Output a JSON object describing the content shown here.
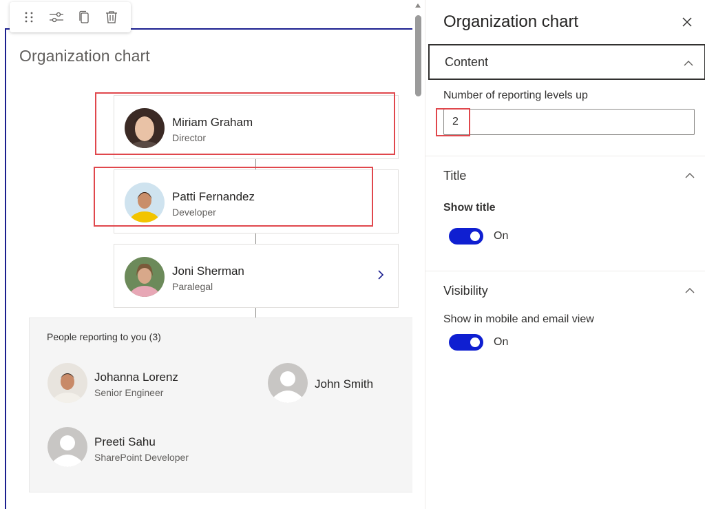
{
  "toolbar": {
    "icons": [
      "drag-handle-icon",
      "settings-sliders-icon",
      "duplicate-icon",
      "delete-trash-icon"
    ]
  },
  "webpart": {
    "title": "Organization chart"
  },
  "chain": [
    {
      "name": "Miriam Graham",
      "role": "Director"
    },
    {
      "name": "Patti Fernandez",
      "role": "Developer"
    },
    {
      "name": "Joni Sherman",
      "role": "Paralegal"
    }
  ],
  "reports": {
    "label": "People reporting to you (3)",
    "people": [
      {
        "name": "Johanna Lorenz",
        "role": "Senior Engineer"
      },
      {
        "name": "John Smith",
        "role": ""
      },
      {
        "name": "Preeti Sahu",
        "role": "SharePoint Developer"
      }
    ]
  },
  "pane": {
    "title": "Organization chart",
    "content": {
      "header": "Content",
      "levels_label": "Number of reporting levels up",
      "levels_value": "2"
    },
    "title_section": {
      "header": "Title",
      "show_title_label": "Show title",
      "show_title_state": "On"
    },
    "visibility": {
      "header": "Visibility",
      "mobile_label": "Show in mobile and email view",
      "mobile_state": "On"
    }
  },
  "colors": {
    "accent": "#0f1fd1",
    "frame": "#1b1f8f",
    "highlight": "#e0474c"
  }
}
